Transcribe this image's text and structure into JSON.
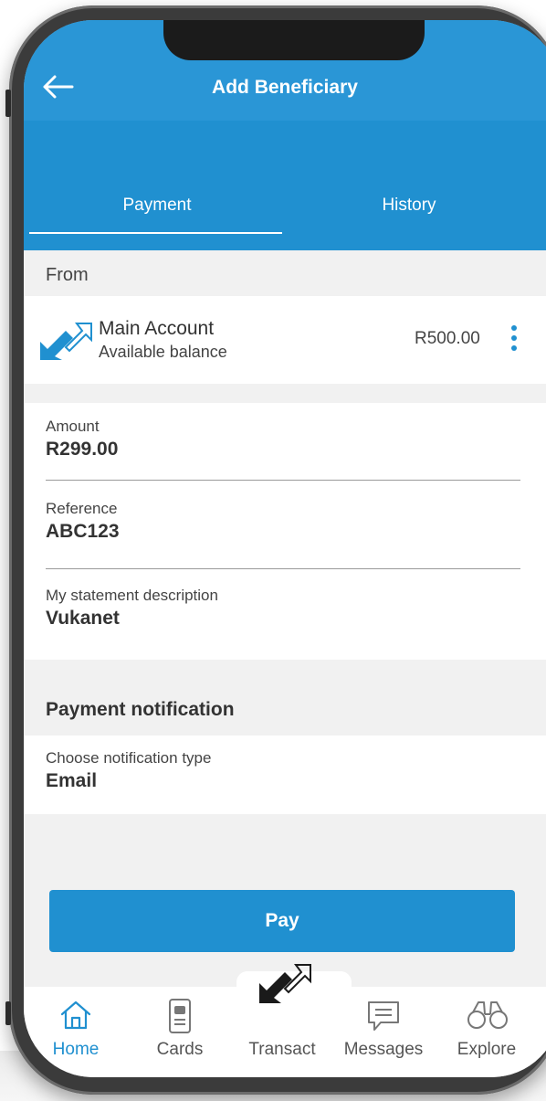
{
  "header": {
    "title": "Add Beneficiary",
    "tabs": [
      {
        "label": "Payment",
        "active": true
      },
      {
        "label": "History",
        "active": false
      }
    ]
  },
  "from": {
    "section_label": "From",
    "account_name": "Main Account",
    "account_sub": "Available balance",
    "balance": "R500.00"
  },
  "fields": {
    "amount": {
      "label": "Amount",
      "value": "R299.00"
    },
    "reference": {
      "label": "Reference",
      "value": "ABC123"
    },
    "statement": {
      "label": "My statement description",
      "value": "Vukanet"
    }
  },
  "notification": {
    "section_label": "Payment notification",
    "type_label": "Choose notification type",
    "type_value": "Email"
  },
  "pay_button": "Pay",
  "nav": {
    "items": [
      {
        "label": "Home",
        "icon": "home-icon",
        "active": true
      },
      {
        "label": "Cards",
        "icon": "cards-icon",
        "active": false
      },
      {
        "label": "Transact",
        "icon": "transact-icon",
        "active": false
      },
      {
        "label": "Messages",
        "icon": "messages-icon",
        "active": false
      },
      {
        "label": "Explore",
        "icon": "explore-icon",
        "active": false
      }
    ]
  },
  "colors": {
    "brand_blue": "#2090d0",
    "background_gray": "#f1f1f1",
    "text_dark": "#333333"
  }
}
